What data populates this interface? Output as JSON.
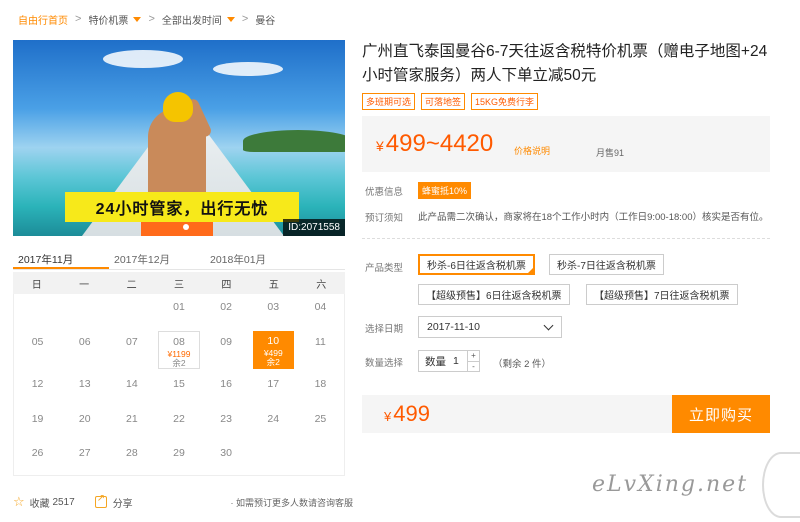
{
  "breadcrumb": {
    "home": "自由行首页",
    "flights": "特价机票",
    "departure": "全部出发时间",
    "destination": "曼谷",
    "separator": ">"
  },
  "hero": {
    "banner": "24小时管家，出行无忧",
    "id_tag": "ID:2071558"
  },
  "calendar": {
    "tabs": [
      "2017年11月",
      "2017年12月",
      "2018年01月"
    ],
    "weekdays": [
      "日",
      "一",
      "二",
      "三",
      "四",
      "五",
      "六"
    ],
    "weeks": [
      [
        "",
        "",
        "",
        "01",
        "02",
        "03",
        "04"
      ],
      [
        "05",
        "06",
        "07",
        "08",
        "09",
        "10",
        "11"
      ],
      [
        "12",
        "13",
        "14",
        "15",
        "16",
        "17",
        "18"
      ],
      [
        "19",
        "20",
        "21",
        "22",
        "23",
        "24",
        "25"
      ],
      [
        "26",
        "27",
        "28",
        "29",
        "30",
        "",
        ""
      ]
    ],
    "available_day": {
      "day": "08",
      "price": "¥1199",
      "left": "余2"
    },
    "selected_day": {
      "day": "10",
      "price": "¥499",
      "left": "余2"
    }
  },
  "bottom": {
    "favorite_label": "收藏",
    "favorite_count": "2517",
    "share_label": "分享",
    "note": "· 如需预订更多人数请咨询客服"
  },
  "product": {
    "title": "广州直飞泰国曼谷6-7天往返含税特价机票（赠电子地图+24小时管家服务）两人下单立减50元",
    "tags": [
      "多班期可选",
      "可落地签",
      "15KG免费行李"
    ],
    "price_currency": "¥",
    "price_range": "499~4420",
    "price_explain": "价格说明",
    "monthly_sales": "月售91"
  },
  "info": {
    "discount_label": "优惠信息",
    "discount_badge": "蜂蜜抵10%",
    "notice_label": "预订须知",
    "notice_text": "此产品需二次确认，商家将在18个工作小时内（工作日9:00-18:00）核实是否有位。"
  },
  "options": {
    "type_label": "产品类型",
    "types": [
      "秒杀-6日往返含税机票",
      "秒杀-7日往返含税机票",
      "【超级预售】6日往返含税机票",
      "【超级预售】7日往返含税机票"
    ],
    "date_label": "选择日期",
    "date_value": "2017-11-10",
    "qty_label": "数量选择",
    "qty_inner_label": "数量",
    "qty_value": "1",
    "qty_plus": "+",
    "qty_minus": "-",
    "remaining": "（剩余 2 件）"
  },
  "purchase": {
    "currency": "¥",
    "total": "499",
    "buy_label": "立即购买"
  },
  "watermark": "eLvXing.net",
  "colors": {
    "accent": "#ff8a00",
    "price": "#ff5a00",
    "banner": "#f7e91a"
  }
}
